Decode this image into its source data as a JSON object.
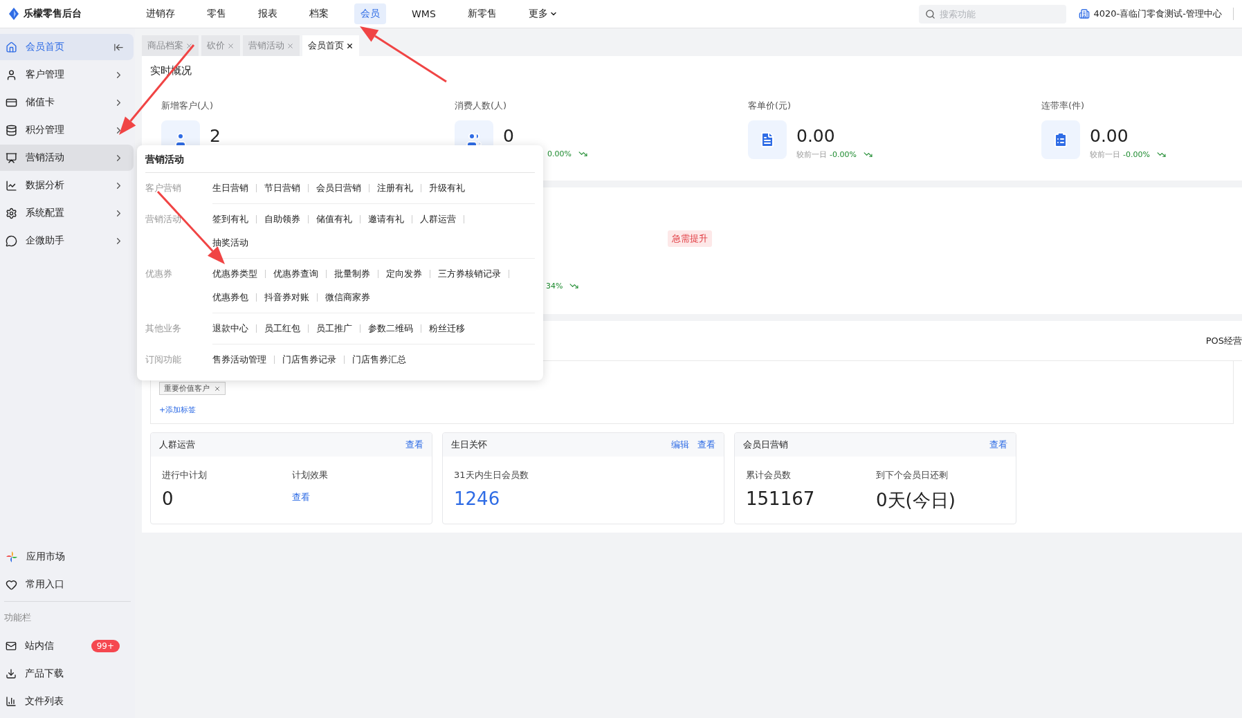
{
  "app": {
    "name": "乐檬零售后台"
  },
  "top_nav": [
    {
      "label": "进销存",
      "selected": false,
      "kind": "link"
    },
    {
      "label": "零售",
      "selected": false,
      "kind": "link"
    },
    {
      "label": "报表",
      "selected": false,
      "kind": "link"
    },
    {
      "label": "档案",
      "selected": false,
      "kind": "link"
    },
    {
      "label": "会员",
      "selected": true,
      "kind": "link"
    },
    {
      "label": "WMS",
      "selected": false,
      "kind": "link"
    },
    {
      "label": "新零售",
      "selected": false,
      "kind": "link"
    },
    {
      "label": "更多",
      "selected": false,
      "kind": "dropdown"
    }
  ],
  "search": {
    "placeholder": "搜索功能"
  },
  "store": {
    "label": "4020-喜临门零食测试-管理中心"
  },
  "sidebar": {
    "items": [
      {
        "label": "会员首页",
        "selected": true,
        "expanded": false
      },
      {
        "label": "客户管理",
        "selected": false,
        "expanded": false
      },
      {
        "label": "储值卡",
        "selected": false,
        "expanded": false
      },
      {
        "label": "积分管理",
        "selected": false,
        "expanded": false
      },
      {
        "label": "营销活动",
        "selected": false,
        "expanded": true
      },
      {
        "label": "数据分析",
        "selected": false,
        "expanded": false
      },
      {
        "label": "系统配置",
        "selected": false,
        "expanded": false
      },
      {
        "label": "企微助手",
        "selected": false,
        "expanded": false
      }
    ],
    "bottom_items": [
      {
        "label": "应用市场"
      },
      {
        "label": "常用入口"
      }
    ],
    "section_title": "功能栏",
    "tool_items": [
      {
        "label": "站内信",
        "badge": "99+"
      },
      {
        "label": "产品下载"
      },
      {
        "label": "文件列表"
      }
    ]
  },
  "tabs": [
    {
      "label": "商品档案",
      "selected": false
    },
    {
      "label": "砍价",
      "selected": false
    },
    {
      "label": "营销活动",
      "selected": false
    },
    {
      "label": "会员首页",
      "selected": true
    }
  ],
  "overview": {
    "title": "实时概况",
    "stats": [
      {
        "label": "新增客户(人)",
        "value": "2"
      },
      {
        "label": "消费人数(人)",
        "value": "0",
        "trend": "0.00%"
      },
      {
        "label": "客单价(元)",
        "value": "0.00",
        "compare_label": "较前一日",
        "trend": "-0.00%"
      },
      {
        "label": "连带率(件)",
        "value": "0.00",
        "compare_label": "较前一日",
        "trend": "-0.00%"
      }
    ]
  },
  "health": {
    "badge": "急需提升",
    "trend": "34%"
  },
  "tags_section": {
    "header_right": "POS经营",
    "tags": [
      {
        "label": "重要价值客户"
      }
    ],
    "add_link": "+添加标签"
  },
  "cards": [
    {
      "title": "人群运营",
      "actions": [
        "查看"
      ],
      "metrics": [
        {
          "label": "进行中计划",
          "value": "0",
          "kind": "number"
        },
        {
          "label": "计划效果",
          "value": "查看",
          "kind": "link"
        }
      ]
    },
    {
      "title": "生日关怀",
      "actions": [
        "编辑",
        "查看"
      ],
      "metrics": [
        {
          "label": "31天内生日会员数",
          "value": "1246",
          "kind": "highlight"
        }
      ]
    },
    {
      "title": "会员日营销",
      "actions": [
        "查看"
      ],
      "metrics": [
        {
          "label": "累计会员数",
          "value": "151167",
          "kind": "number"
        },
        {
          "label": "到下个会员日还剩",
          "value": "0天(今日)",
          "kind": "number"
        }
      ]
    }
  ],
  "popup": {
    "title": "营销活动",
    "groups": [
      {
        "label": "客户营销",
        "rows": [
          [
            "生日营销",
            "节日营销",
            "会员日营销",
            "注册有礼",
            "升级有礼"
          ]
        ]
      },
      {
        "label": "营销活动",
        "rows": [
          [
            "签到有礼",
            "自助领券",
            "储值有礼",
            "邀请有礼",
            "人群运营"
          ],
          [
            "抽奖活动"
          ]
        ]
      },
      {
        "label": "优惠券",
        "rows": [
          [
            "优惠券类型",
            "优惠券查询",
            "批量制券",
            "定向发券",
            "三方券核销记录"
          ],
          [
            "优惠券包",
            "抖音券对账",
            "微信商家券"
          ]
        ]
      },
      {
        "label": "其他业务",
        "rows": [
          [
            "退款中心",
            "员工红包",
            "员工推广",
            "参数二维码",
            "粉丝迁移"
          ]
        ]
      },
      {
        "label": "订阅功能",
        "rows": [
          [
            "售券活动管理",
            "门店售券记录",
            "门店售券汇总"
          ]
        ]
      }
    ]
  }
}
